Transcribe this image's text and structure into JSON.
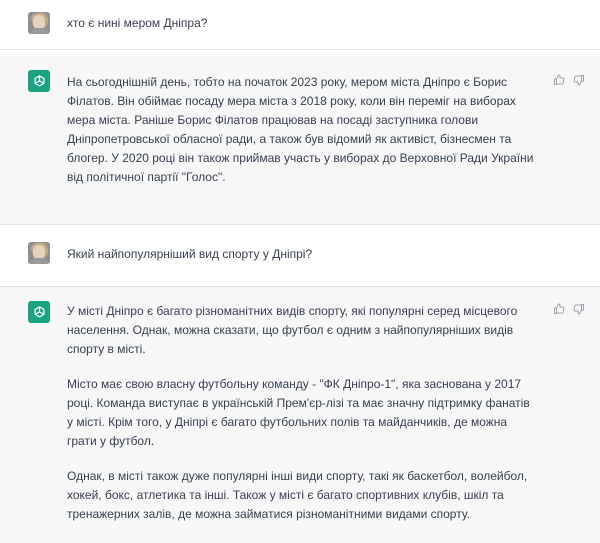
{
  "conversation": [
    {
      "role": "user",
      "text": "хто є нині мером Дніпра?"
    },
    {
      "role": "assistant",
      "paragraphs": [
        "На сьогоднішній день, тобто на початок 2023 року, мером міста Дніпро є Борис Філатов. Він обіймає посаду мера міста з 2018 року, коли він переміг на виборах мера міста. Раніше Борис Філатов працював на посаді заступника голови Дніпропетровської обласної ради, а також був відомий як активіст, бізнесмен та блогер. У 2020 році він також приймав участь у виборах до Верховної Ради України від політичної партії \"Голос\"."
      ]
    },
    {
      "role": "user",
      "text": "Який найпопулярніший вид спорту у Дніпрі?"
    },
    {
      "role": "assistant",
      "paragraphs": [
        "У місті Дніпро є багато різноманітних видів спорту, які популярні серед місцевого населення. Однак, можна сказати, що футбол є одним з найпопулярніших видів спорту в місті.",
        "Місто має свою власну футбольну команду - \"ФК Дніпро-1\", яка заснована у 2017 році. Команда виступає в українській Прем'єр-лізі та має значну підтримку фанатів у місті. Крім того, у Дніпрі є багато футбольних полів та майданчиків, де можна грати у футбол.",
        "Однак, в місті також дуже популярні інші види спорту, такі як баскетбол, волейбол, хокей, бокс, атлетика та інші. Також у місті є багато спортивних клубів, шкіл та тренажерних залів, де можна займатися різноманітними видами спорту."
      ]
    }
  ],
  "icons": {
    "assistant_logo": "openai-logo-icon",
    "like": "thumbs-up-icon",
    "dislike": "thumbs-down-icon"
  },
  "colors": {
    "assistant_bg": "#f7f7f8",
    "logo_bg": "#19a37f",
    "text": "#374151"
  }
}
